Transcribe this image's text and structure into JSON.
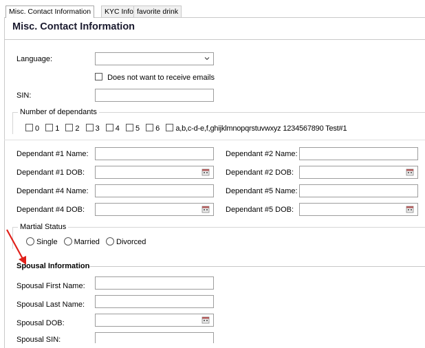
{
  "tabs": [
    "Misc. Contact Information",
    "KYC Info",
    "favorite drink"
  ],
  "section_title": "Misc. Contact Information",
  "form": {
    "language_label": "Language:",
    "language_value": "",
    "no_emails_label": "Does not want to receive emails",
    "sin_label": "SIN:",
    "sin_value": ""
  },
  "dependants": {
    "group_title": "Number of dependants",
    "options": [
      "0",
      "1",
      "2",
      "3",
      "4",
      "5",
      "6",
      "a,b,c-d-e,f,ghijklmnopqrstuvwxyz 1234567890 Test#1"
    ],
    "fields": {
      "dep1_name": "Dependant #1 Name:",
      "dep2_name": "Dependant #2 Name:",
      "dep1_dob": "Dependant #1 DOB:",
      "dep2_dob": "Dependant #2 DOB:",
      "dep4_name": "Dependant #4 Name:",
      "dep5_name": "Dependant #5 Name:",
      "dep4_dob": "Dependant #4 DOB:",
      "dep5_dob": "Dependant #5 DOB:"
    }
  },
  "marital": {
    "group_title": "Martial Status",
    "options": [
      "Single",
      "Married",
      "Divorced"
    ]
  },
  "spousal": {
    "header": "Spousal Information",
    "first_name_label": "Spousal First Name:",
    "last_name_label": "Spousal Last Name:",
    "dob_label": "Spousal DOB:",
    "sin_label": "Spousal SIN:"
  },
  "colors": {
    "annotation_arrow": "#e0201a",
    "input_border": "#9c9c9c",
    "title_text": "#1a1a2e"
  },
  "icons": {
    "select": "chevron-down-icon",
    "date": "calendar-icon",
    "annotation": "red-arrow-icon"
  }
}
